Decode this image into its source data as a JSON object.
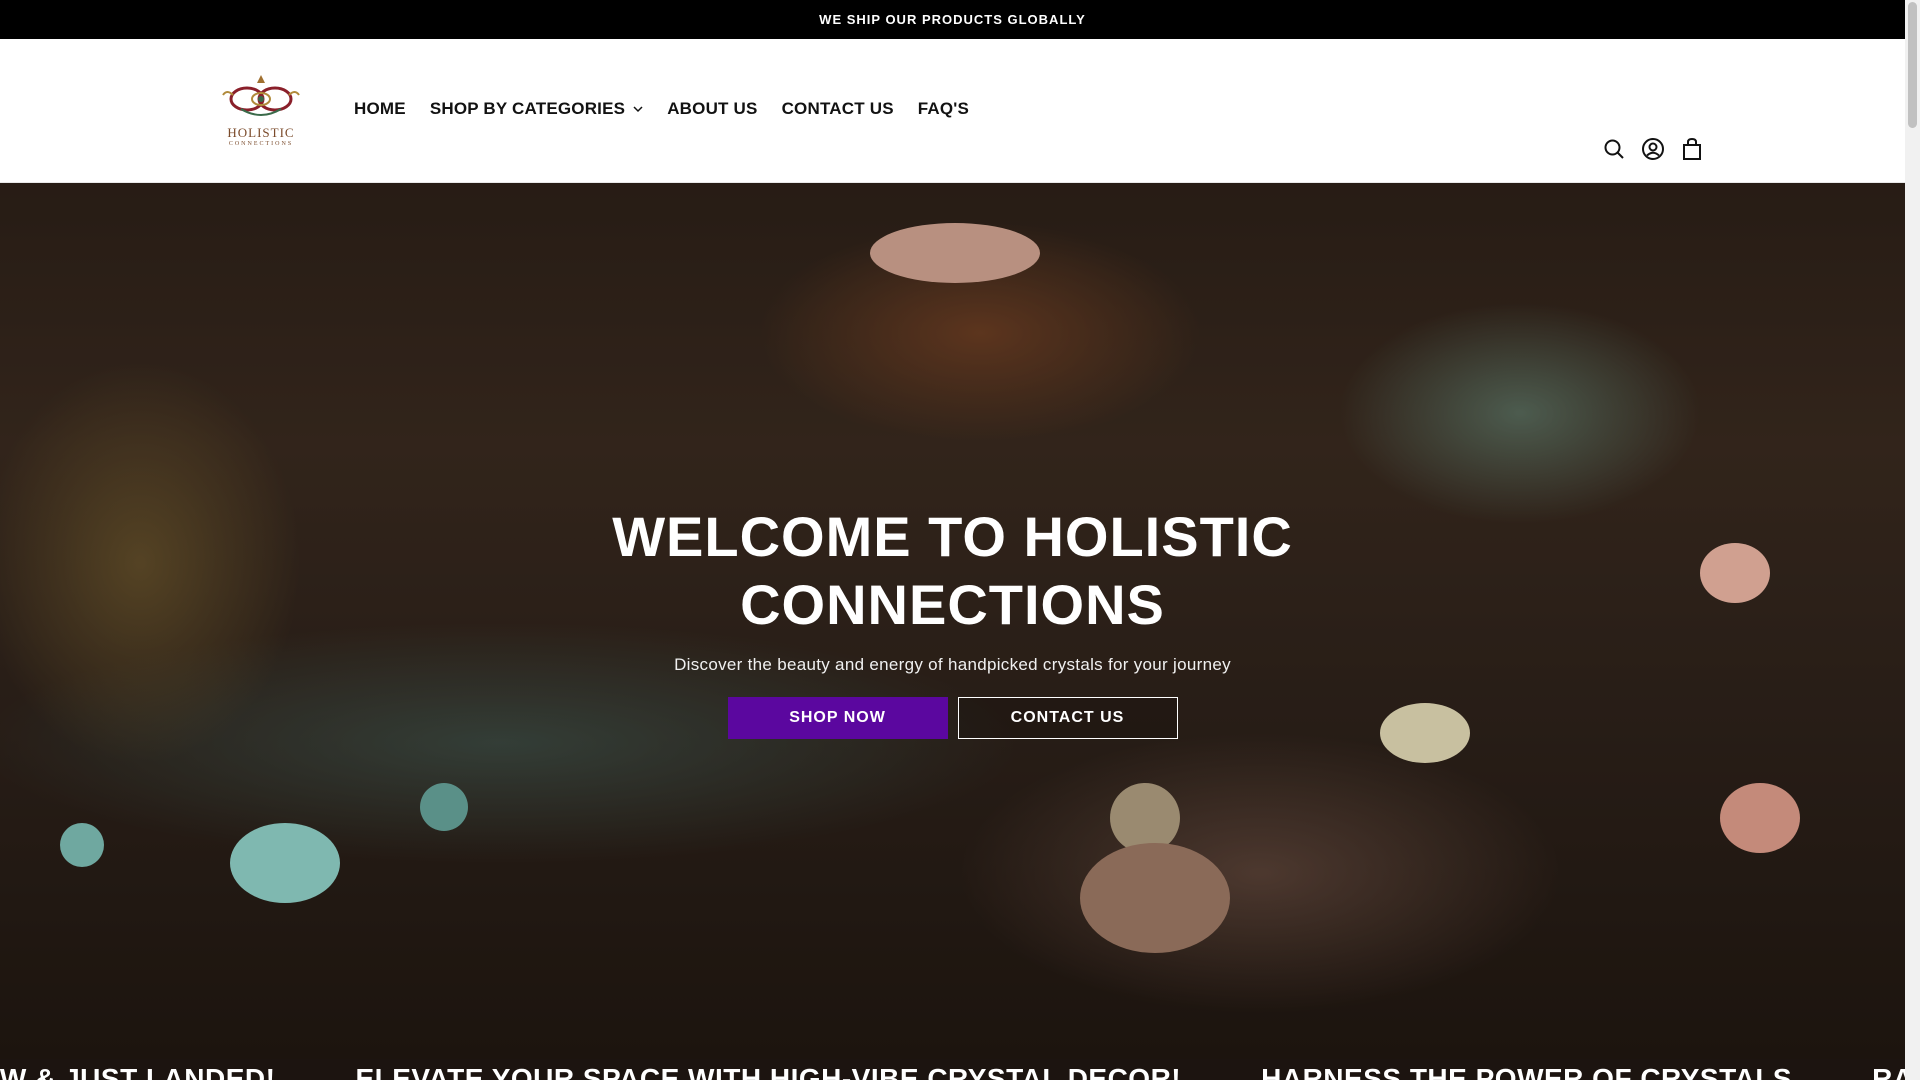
{
  "announcement": {
    "text": "WE SHIP OUR PRODUCTS GLOBALLY"
  },
  "header": {
    "logo": {
      "word": "HOLISTIC",
      "sub": "CONNECTIONS"
    },
    "nav": [
      {
        "label": "HOME"
      },
      {
        "label": "SHOP BY CATEGORIES"
      },
      {
        "label": "ABOUT US"
      },
      {
        "label": "CONTACT US"
      },
      {
        "label": "FAQ'S"
      }
    ],
    "icons": [
      "search-icon",
      "account-icon",
      "cart-icon"
    ]
  },
  "hero": {
    "title": "WELCOME TO HOLISTIC CONNECTIONS",
    "subtitle": "Discover the beauty and energy of handpicked crystals for your journey",
    "primary_button": "SHOP NOW",
    "secondary_button": "CONTACT US"
  },
  "marquee": {
    "items": [
      "NEW & JUST LANDED!",
      "ELEVATE YOUR SPACE WITH HIGH-VIBE CRYSTAL DECOR!",
      "HARNESS THE POWER OF CRYSTALS",
      "RARE & UNIQUE CRYSTALS JUST LANDED!"
    ]
  },
  "colors": {
    "accent": "#5b079f",
    "announcement_bg": "#000000",
    "text": "#121212"
  }
}
